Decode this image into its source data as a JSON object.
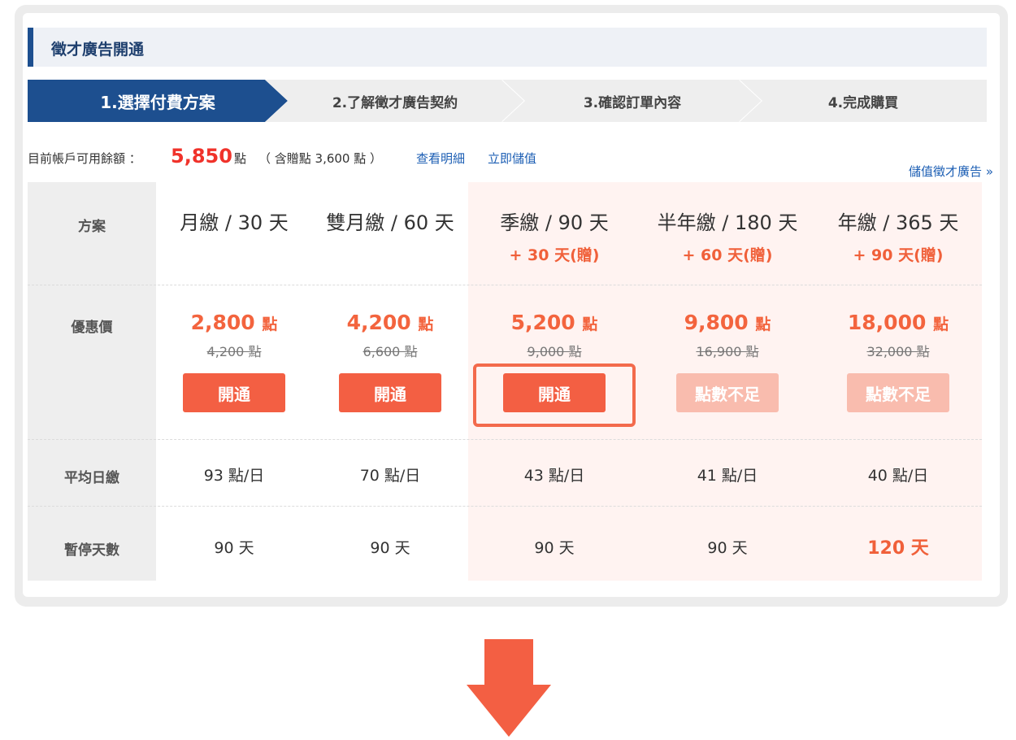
{
  "panel": {
    "title": "徵才廣告開通"
  },
  "steps": [
    "1.選擇付費方案",
    "2.了解徵才廣告契約",
    "3.確認訂單內容",
    "4.完成購買"
  ],
  "balance": {
    "label": "目前帳戶可用餘額 ：",
    "amount": "5,850",
    "unit": "點",
    "bonus": "（ 含贈點 3,600 點 ）",
    "link_details": "查看明細",
    "link_deposit": "立即儲值"
  },
  "topup_link": "儲值徵才廣告 »",
  "row_labels": {
    "plan": "方案",
    "price": "優惠價",
    "daily": "平均日繳",
    "pause": "暫停天數"
  },
  "plans": [
    {
      "name": "月繳 / 30 天",
      "gift": "",
      "price": "2,800",
      "price_unit": "點",
      "original": "4,200 點",
      "button": "開通",
      "enabled": true,
      "daily": "93 點/日",
      "pause": "90 天",
      "highlight": false
    },
    {
      "name": "雙月繳 / 60 天",
      "gift": "",
      "price": "4,200",
      "price_unit": "點",
      "original": "6,600 點",
      "button": "開通",
      "enabled": true,
      "daily": "70 點/日",
      "pause": "90 天",
      "highlight": false
    },
    {
      "name": "季繳 / 90 天",
      "gift": "+ 30 天(贈)",
      "price": "5,200",
      "price_unit": "點",
      "original": "9,000 點",
      "button": "開通",
      "enabled": true,
      "daily": "43 點/日",
      "pause": "90 天",
      "highlight": true
    },
    {
      "name": "半年繳 / 180 天",
      "gift": "+ 60 天(贈)",
      "price": "9,800",
      "price_unit": "點",
      "original": "16,900 點",
      "button": "點數不足",
      "enabled": false,
      "daily": "41 點/日",
      "pause": "90 天",
      "highlight": true
    },
    {
      "name": "年繳 / 365 天",
      "gift": "+ 90 天(贈)",
      "price": "18,000",
      "price_unit": "點",
      "original": "32,000 點",
      "button": "點數不足",
      "enabled": false,
      "daily": "40 點/日",
      "pause": "120 天",
      "highlight": true
    }
  ],
  "colors": {
    "brand_blue": "#1d4f8f",
    "accent_orange": "#f35f43",
    "disabled_orange": "#f9bcae",
    "balance_red": "#f0322a",
    "link_blue": "#1d5fb4"
  }
}
